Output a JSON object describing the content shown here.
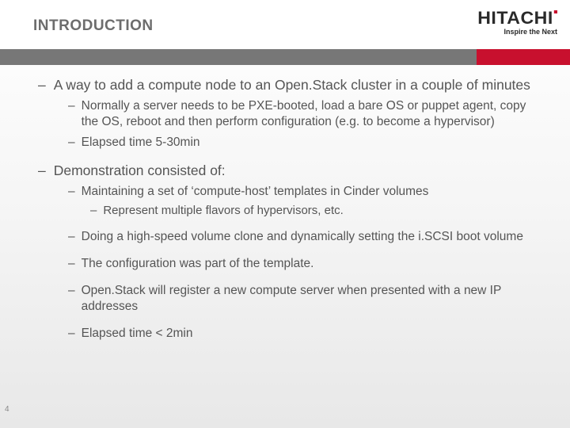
{
  "header": {
    "title": "INTRODUCTION",
    "logo_main": "HITACHI",
    "logo_sub": "Inspire the Next"
  },
  "bullets": {
    "b1": "A way to add a compute node to an Open.Stack cluster in a couple of minutes",
    "b1_1": "Normally a server needs to be PXE-booted, load a bare OS or puppet agent, copy the OS, reboot and then perform configuration (e.g. to become a hypervisor)",
    "b1_2": "Elapsed time 5-30min",
    "b2": "Demonstration consisted of:",
    "b2_1": "Maintaining a set of ‘compute-host’ templates in Cinder volumes",
    "b2_1_1": "Represent multiple flavors of hypervisors, etc.",
    "b2_2": "Doing a high-speed volume clone and dynamically setting the i.SCSI boot volume",
    "b2_3": "The configuration was part of the template.",
    "b2_4": "Open.Stack will register a new compute server when presented with a new IP addresses",
    "b2_5": "Elapsed time < 2min"
  },
  "page_number": "4"
}
